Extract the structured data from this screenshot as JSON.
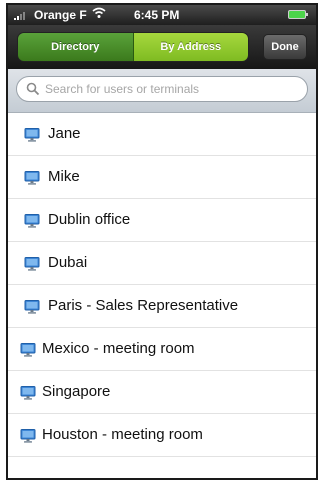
{
  "status_bar": {
    "carrier": "Orange F",
    "time": "6:45 PM",
    "wifi_icon": "wifi-icon",
    "battery_icon": "battery-icon"
  },
  "nav_bar": {
    "segments": [
      {
        "label": "Directory",
        "selected": false
      },
      {
        "label": "By Address",
        "selected": true
      }
    ],
    "done_label": "Done"
  },
  "search": {
    "placeholder": "Search for users or terminals",
    "value": ""
  },
  "contacts": [
    {
      "name": "Jane",
      "icon": "monitor-icon"
    },
    {
      "name": "Mike",
      "icon": "monitor-icon"
    },
    {
      "name": "Dublin office",
      "icon": "monitor-icon"
    },
    {
      "name": "Dubai",
      "icon": "monitor-icon"
    },
    {
      "name": "Paris - Sales Representative",
      "icon": "monitor-icon"
    },
    {
      "name": "Mexico - meeting room",
      "icon": "monitor-icon"
    },
    {
      "name": "Singapore",
      "icon": "monitor-icon"
    },
    {
      "name": "Houston - meeting room",
      "icon": "monitor-icon"
    }
  ],
  "colors": {
    "segment_selected": "#8cc62a",
    "segment_unselected": "#4a8f2a",
    "nav_background": "#1e1e1e"
  }
}
